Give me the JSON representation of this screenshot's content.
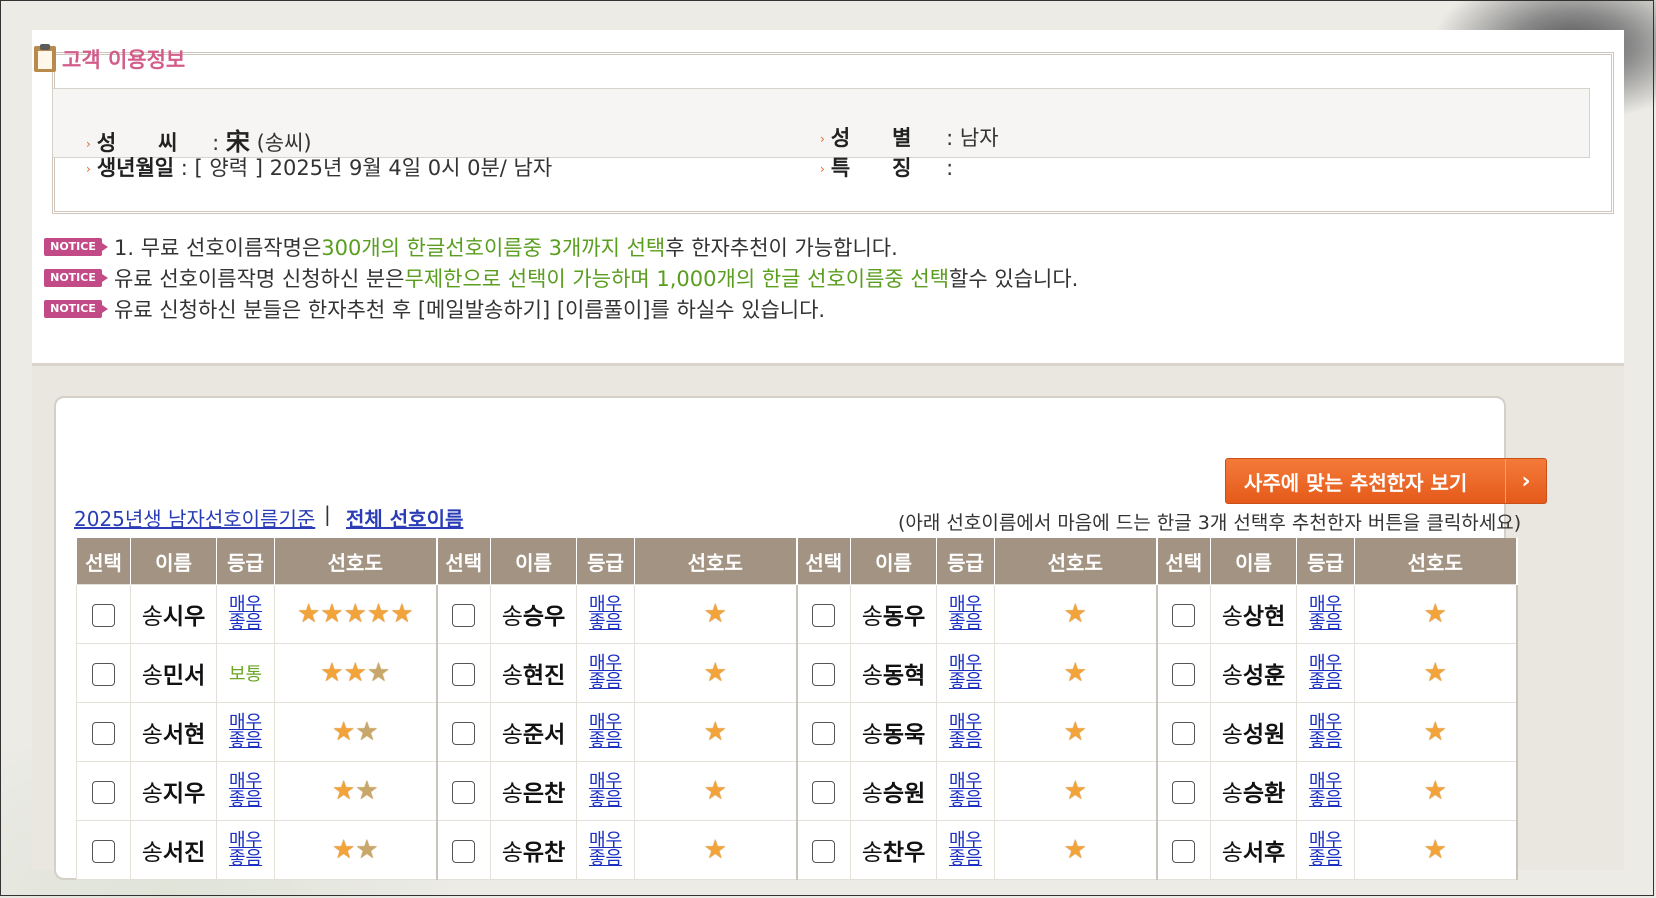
{
  "info": {
    "title": "고객 이용정보",
    "surname_label": "성　　씨",
    "surname_hanja": "宋",
    "surname_hangul": "(송씨)",
    "gender_label": "성　　별",
    "gender_value": "남자",
    "birth_label": "생년월일",
    "birth_value": "[ 양력 ] 2025년 9월 4일 0시 0분/ 남자",
    "feature_label": "특　　징",
    "feature_value": ""
  },
  "notices": {
    "badge": "NOTICE",
    "n1_a": "1. 무료 선호이름작명은 ",
    "n1_b": "300개의 한글선호이름중 3개까지 선택",
    "n1_c": "후 한자추천이 가능합니다.",
    "n2_a": "유료 선호이름작명 신청하신 분은",
    "n2_b": "무제한으로 선택이 가능하며 1,000개의 한글 선호이름중 선택",
    "n2_c": "할수 있습니다.",
    "n3": "유료 신청하신 분들은 한자추천 후 [메일발송하기] [이름풀이]를 하실수 있습니다."
  },
  "controls": {
    "recommend_button": "사주에 맞는 추천한자 보기",
    "tab_2025": "2025년생 남자선호이름기준",
    "tab_separator": "|",
    "tab_all": "전체 선호이름",
    "hint": "(아래 선호이름에서 마음에 드는 한글 3개 선택후 추천한자 버튼을 클릭하세요)"
  },
  "table": {
    "headers": [
      "선택",
      "이름",
      "등급",
      "선호도"
    ],
    "surname": "송",
    "rows": [
      [
        {
          "given": "시우",
          "grade": "매우좋음",
          "stars": 5
        },
        {
          "given": "승우",
          "grade": "매우좋음",
          "stars": 1
        },
        {
          "given": "동우",
          "grade": "매우좋음",
          "stars": 1
        },
        {
          "given": "상현",
          "grade": "매우좋음",
          "stars": 1
        }
      ],
      [
        {
          "given": "민서",
          "grade": "보통",
          "stars": 3
        },
        {
          "given": "현진",
          "grade": "매우좋음",
          "stars": 1
        },
        {
          "given": "동혁",
          "grade": "매우좋음",
          "stars": 1
        },
        {
          "given": "성훈",
          "grade": "매우좋음",
          "stars": 1
        }
      ],
      [
        {
          "given": "서현",
          "grade": "매우좋음",
          "stars": 2
        },
        {
          "given": "준서",
          "grade": "매우좋음",
          "stars": 1
        },
        {
          "given": "동욱",
          "grade": "매우좋음",
          "stars": 1
        },
        {
          "given": "성원",
          "grade": "매우좋음",
          "stars": 1
        }
      ],
      [
        {
          "given": "지우",
          "grade": "매우좋음",
          "stars": 2
        },
        {
          "given": "은찬",
          "grade": "매우좋음",
          "stars": 1
        },
        {
          "given": "승원",
          "grade": "매우좋음",
          "stars": 1
        },
        {
          "given": "승환",
          "grade": "매우좋음",
          "stars": 1
        }
      ],
      [
        {
          "given": "서진",
          "grade": "매우좋음",
          "stars": 2
        },
        {
          "given": "유찬",
          "grade": "매우좋음",
          "stars": 1
        },
        {
          "given": "찬우",
          "grade": "매우좋음",
          "stars": 1
        },
        {
          "given": "서후",
          "grade": "매우좋음",
          "stars": 1
        }
      ]
    ]
  },
  "colors": {
    "accent_pink": "#c14a87",
    "header_brown": "#a39383",
    "button_orange": "#e55a1a",
    "link_blue": "#2a3db6",
    "highlight_green": "#5a9e1f"
  }
}
